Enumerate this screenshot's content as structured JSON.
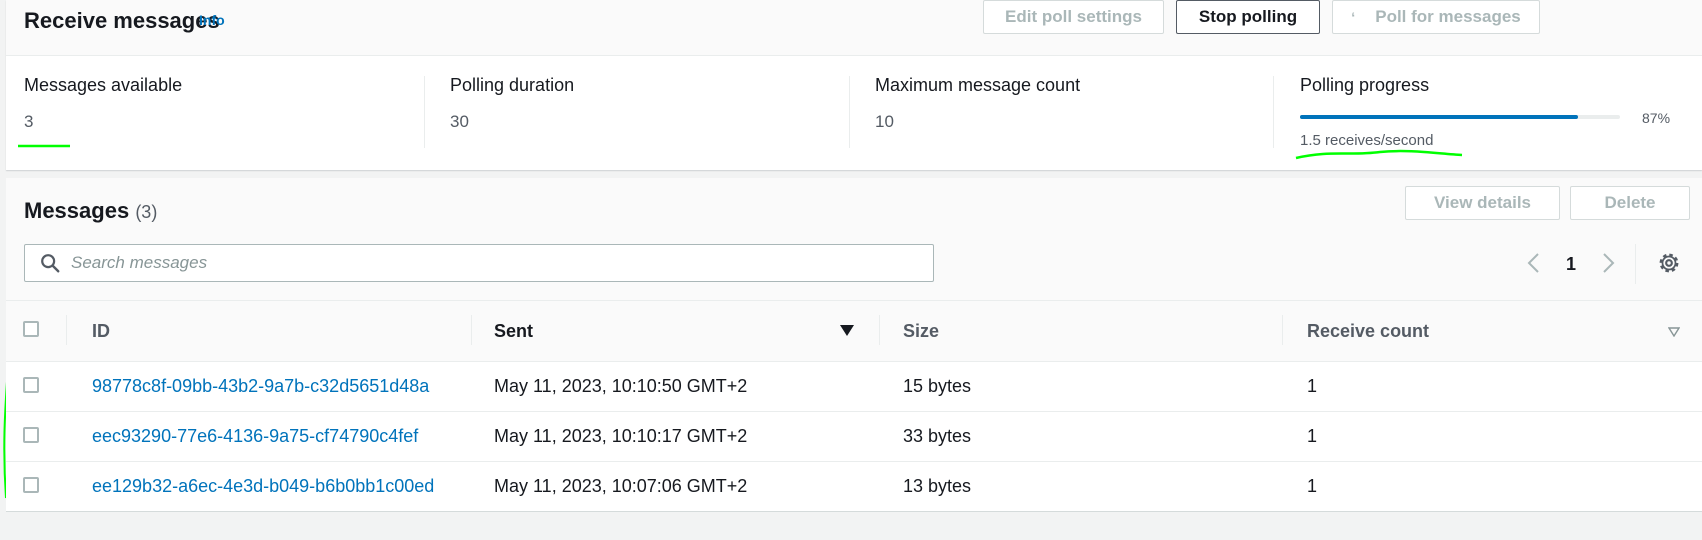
{
  "header": {
    "title": "Receive messages",
    "info_label": "Info",
    "buttons": {
      "edit_poll_settings": "Edit poll settings",
      "stop_polling": "Stop polling",
      "poll_for_messages": "Poll for messages"
    }
  },
  "metrics": {
    "messages_available": {
      "label": "Messages available",
      "value": "3"
    },
    "polling_duration": {
      "label": "Polling duration",
      "value": "30"
    },
    "max_message_count": {
      "label": "Maximum message count",
      "value": "10"
    },
    "polling_progress": {
      "label": "Polling progress",
      "percent_label": "87%",
      "fraction": 0.87,
      "rate": "1.5 receives/second"
    }
  },
  "messages": {
    "title": "Messages",
    "count": "(3)",
    "view_details_label": "View details",
    "delete_label": "Delete",
    "search_placeholder": "Search messages",
    "page": "1",
    "columns": {
      "id": "ID",
      "sent": "Sent",
      "size": "Size",
      "receive_count": "Receive count"
    },
    "rows": [
      {
        "id": "98778c8f-09bb-43b2-9a7b-c32d5651d48a",
        "sent": "May 11, 2023, 10:10:50 GMT+2",
        "size": "15 bytes",
        "receive_count": "1"
      },
      {
        "id": "eec93290-77e6-4136-9a75-cf74790c4fef",
        "sent": "May 11, 2023, 10:10:17 GMT+2",
        "size": "33 bytes",
        "receive_count": "1"
      },
      {
        "id": "ee129b32-a6ec-4e3d-b049-b6b0bb1c00ed",
        "sent": "May 11, 2023, 10:07:06 GMT+2",
        "size": "13 bytes",
        "receive_count": "1"
      }
    ]
  },
  "colors": {
    "accent": "#0073bb",
    "annotation": "#00ff00",
    "text": "#16191f",
    "muted": "#545b64"
  }
}
